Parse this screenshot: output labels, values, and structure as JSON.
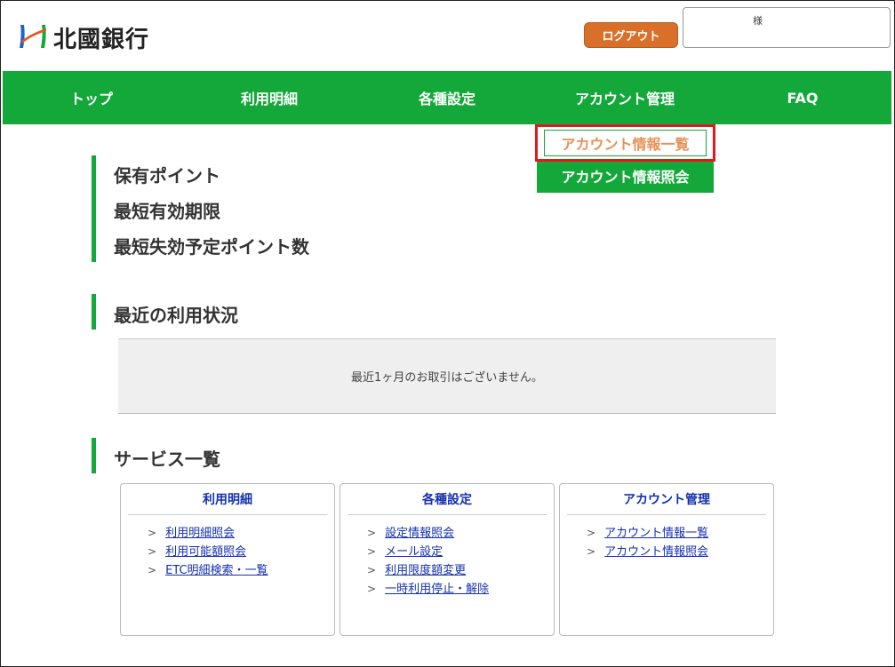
{
  "header": {
    "bank_name": "北國銀行",
    "logout_label": "ログアウト",
    "user_suffix": "様",
    "colors": {
      "accent": "#14a83b",
      "logout": "#d9702a",
      "link": "#1430b0",
      "highlight_border": "#e01a1a"
    }
  },
  "nav": {
    "items": [
      {
        "label": "トップ"
      },
      {
        "label": "利用明細"
      },
      {
        "label": "各種設定"
      },
      {
        "label": "アカウント管理"
      },
      {
        "label": "FAQ"
      }
    ]
  },
  "dropdown": {
    "items": [
      {
        "label": "アカウント情報一覧"
      },
      {
        "label": "アカウント情報照会"
      }
    ]
  },
  "points": {
    "lines": [
      "保有ポイント",
      "最短有効期限",
      "最短失効予定ポイント数"
    ]
  },
  "recent": {
    "heading": "最近の利用状況",
    "notice": "最近1ヶ月のお取引はございません。"
  },
  "services": {
    "heading": "サービス一覧",
    "cards": [
      {
        "title": "利用明細",
        "links": [
          "利用明細照会",
          "利用可能額照会",
          "ETC明細検索・一覧"
        ]
      },
      {
        "title": "各種設定",
        "links": [
          "設定情報照会",
          "メール設定",
          "利用限度額変更",
          "一時利用停止・解除"
        ]
      },
      {
        "title": "アカウント管理",
        "links": [
          "アカウント情報一覧",
          "アカウント情報照会"
        ]
      }
    ]
  }
}
